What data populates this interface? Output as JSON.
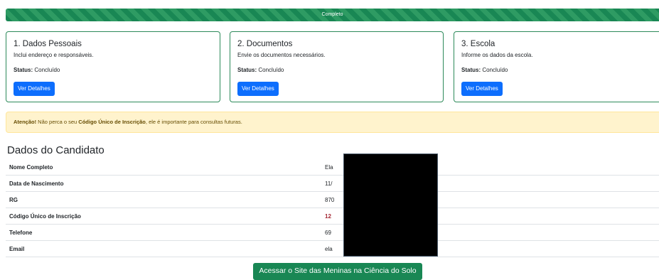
{
  "progress": {
    "label": "Completo",
    "percent": 100
  },
  "cards": [
    {
      "title": "1. Dados Pessoais",
      "description": "Inclui endereço e responsáveis.",
      "status_label": "Status:",
      "status_value": "Concluído",
      "button": "Ver Detalhes"
    },
    {
      "title": "2. Documentos",
      "description": "Envie os documentos necessários.",
      "status_label": "Status:",
      "status_value": "Concluído",
      "button": "Ver Detalhes"
    },
    {
      "title": "3. Escola",
      "description": "Informe os dados da escola.",
      "status_label": "Status:",
      "status_value": "Concluído",
      "button": "Ver Detalhes"
    }
  ],
  "alert": {
    "strong": "Atenção!",
    "text1": " Não perca o seu ",
    "code_name": "Código Único de Inscrição",
    "text2": ", ele é importante para consultas futuras."
  },
  "section_title": "Dados do Candidato",
  "rows": [
    {
      "label": "Nome Completo",
      "value": "Ela"
    },
    {
      "label": "Data de Nascimento",
      "value": "11/"
    },
    {
      "label": "RG",
      "value": "870"
    },
    {
      "label": "Código Único de Inscrição",
      "value": "12"
    },
    {
      "label": "Telefone",
      "value": "69"
    },
    {
      "label": "Email",
      "value": "ela"
    }
  ],
  "site_button": "Acessar o Site das Meninas na Ciência do Solo",
  "colors": {
    "success": "#198754",
    "primary": "#0d6efd",
    "alert_bg": "#fff3cd",
    "alert_text": "#664d03",
    "code_value": "#a52834"
  }
}
